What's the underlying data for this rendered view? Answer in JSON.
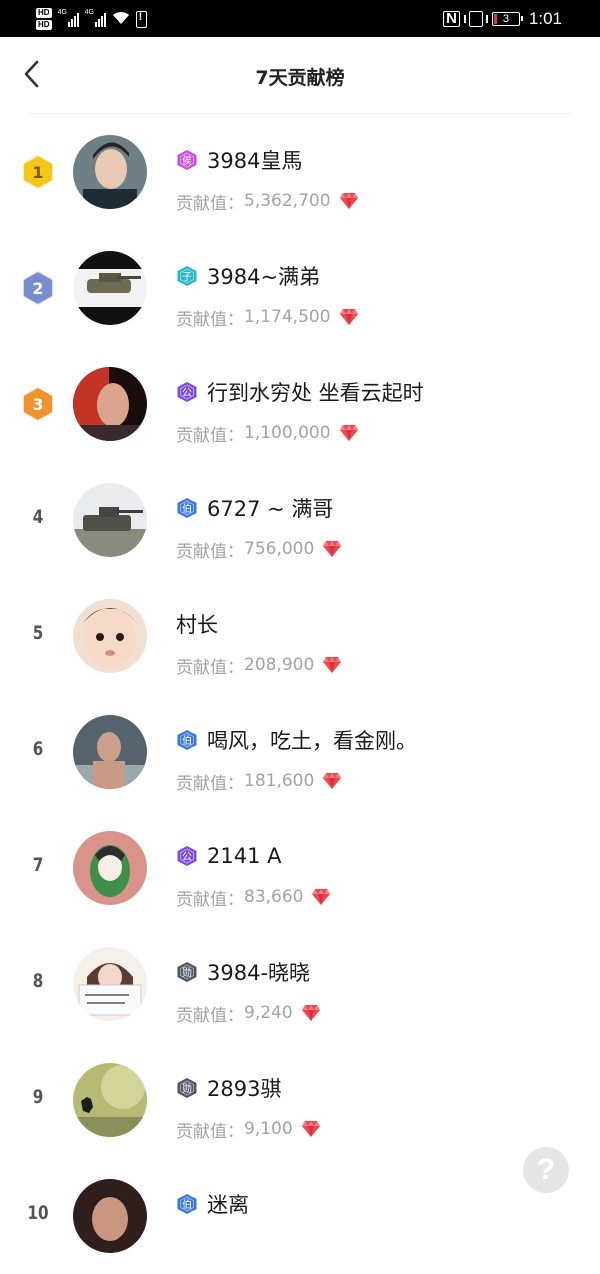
{
  "status_bar": {
    "hd1": "HD",
    "hd2": "HD",
    "net1": "4G",
    "net2": "4G",
    "nfc": "N",
    "battery": "3",
    "time": "1:01"
  },
  "header": {
    "title": "7天贡献榜",
    "back_icon": "chevron-left-icon"
  },
  "contrib_label": "贡献值：",
  "colors": {
    "gold": "#f5c518",
    "silver": "#7b8bd0",
    "bronze": "#f0922e",
    "gem": "#f0474f"
  },
  "rows": [
    {
      "rank": "1",
      "level": "侯",
      "level_color": "#c84fd6",
      "name": "3984皇馬",
      "contrib": "5,362,700"
    },
    {
      "rank": "2",
      "level": "子",
      "level_color": "#27b7c9",
      "name": "3984~满弟",
      "contrib": "1,174,500"
    },
    {
      "rank": "3",
      "level": "公",
      "level_color": "#7a4fd6",
      "name": "行到水穷处 坐看云起时",
      "contrib": "1,100,000"
    },
    {
      "rank": "4",
      "level": "伯",
      "level_color": "#3a78e0",
      "name": "6727 ~ 满哥",
      "contrib": "756,000"
    },
    {
      "rank": "5",
      "level": "",
      "level_color": "",
      "name": "村长",
      "contrib": "208,900"
    },
    {
      "rank": "6",
      "level": "伯",
      "level_color": "#3a78e0",
      "name": "喝风，吃土，看金刚。",
      "contrib": "181,600"
    },
    {
      "rank": "7",
      "level": "公",
      "level_color": "#7a4fd6",
      "name": "2141 A",
      "contrib": "83,660"
    },
    {
      "rank": "8",
      "level": "勋",
      "level_color": "#4d5666",
      "name": "3984-晓晓",
      "contrib": "9,240"
    },
    {
      "rank": "9",
      "level": "勋",
      "level_color": "#4d5666",
      "name": "2893骐",
      "contrib": "9,100"
    },
    {
      "rank": "10",
      "level": "伯",
      "level_color": "#3a78e0",
      "name": "迷离",
      "contrib": ""
    }
  ],
  "help": {
    "label": "?"
  }
}
